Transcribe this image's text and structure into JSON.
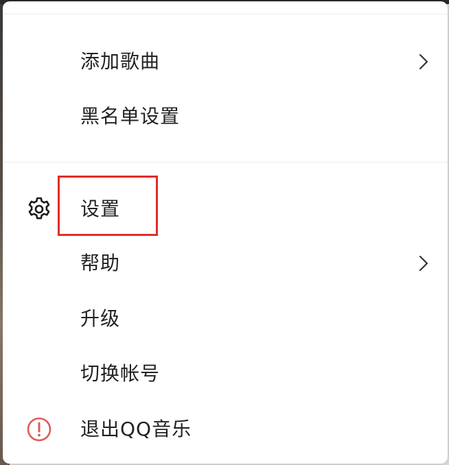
{
  "menu": {
    "items": [
      {
        "label": "添加歌曲",
        "icon": null,
        "has_submenu": true
      },
      {
        "label": "黑名单设置",
        "icon": null,
        "has_submenu": false
      },
      {
        "label": "设置",
        "icon": "gear-icon",
        "has_submenu": false,
        "highlighted": true
      },
      {
        "label": "帮助",
        "icon": null,
        "has_submenu": true
      },
      {
        "label": "升级",
        "icon": null,
        "has_submenu": false
      },
      {
        "label": "切换帐号",
        "icon": null,
        "has_submenu": false
      },
      {
        "label": "退出QQ音乐",
        "icon": "exclamation-circle-icon",
        "has_submenu": false
      }
    ]
  },
  "colors": {
    "highlight_border": "#e32b2b",
    "exit_icon": "#e05a5a",
    "text": "#222222"
  }
}
